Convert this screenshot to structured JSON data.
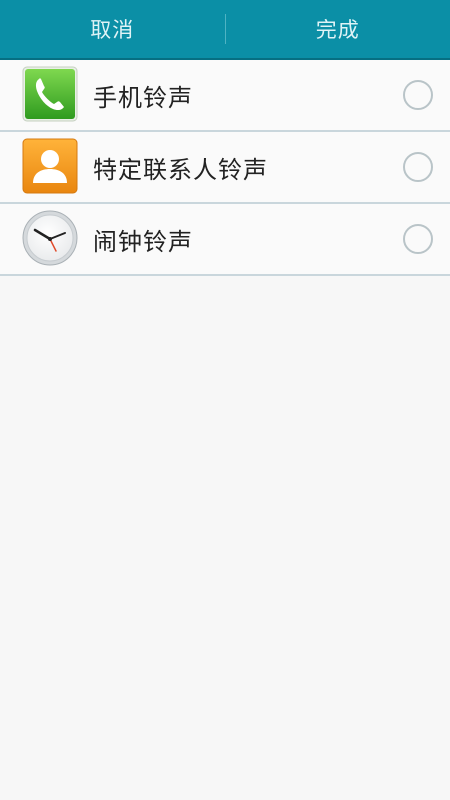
{
  "topbar": {
    "cancel_label": "取消",
    "done_label": "完成"
  },
  "list": {
    "items": [
      {
        "label": "手机铃声",
        "icon": "phone-icon",
        "selected": false
      },
      {
        "label": "特定联系人铃声",
        "icon": "contact-icon",
        "selected": false
      },
      {
        "label": "闹钟铃声",
        "icon": "clock-icon",
        "selected": false
      }
    ]
  },
  "colors": {
    "topbar_bg": "#0b8fa6",
    "phone_green": "#3fb62e",
    "contact_orange": "#f39a1d",
    "clock_hand_red": "#e04a2b"
  }
}
